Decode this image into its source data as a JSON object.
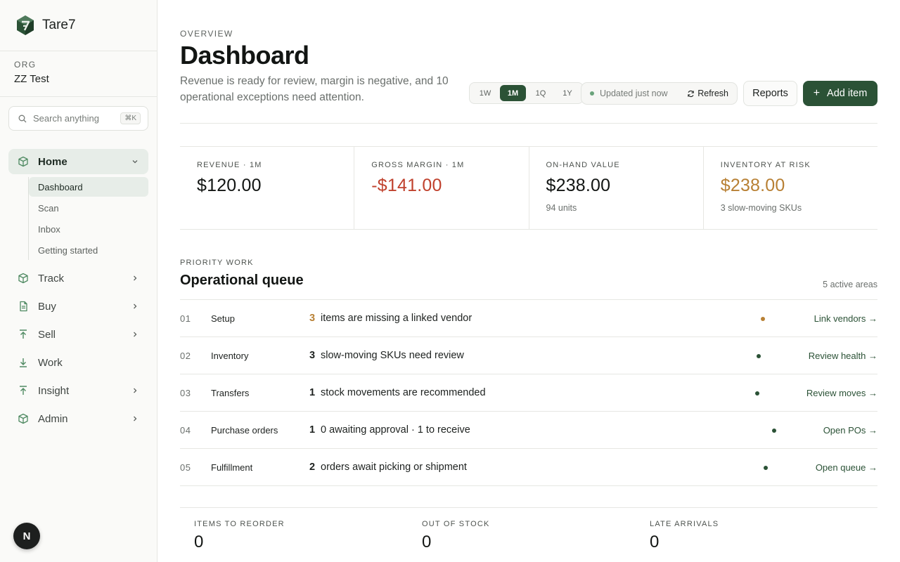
{
  "brand": {
    "name": "Tare7"
  },
  "org": {
    "label": "ORG",
    "name": "ZZ Test"
  },
  "search": {
    "placeholder": "Search anything",
    "shortcut": "⌘K"
  },
  "nav": {
    "home": "Home",
    "sub": [
      "Dashboard",
      "Scan",
      "Inbox",
      "Getting started"
    ],
    "track": "Track",
    "buy": "Buy",
    "sell": "Sell",
    "work": "Work",
    "insight": "Insight",
    "admin": "Admin"
  },
  "user": {
    "initial": "N"
  },
  "header": {
    "eyebrow": "OVERVIEW",
    "title": "Dashboard",
    "subtitle": "Revenue is ready for review, margin is negative, and 10 operational exceptions need attention."
  },
  "range": {
    "options": [
      "1W",
      "1M",
      "1Q",
      "1Y"
    ],
    "selected": "1M"
  },
  "status": {
    "updated": "Updated just now",
    "refresh": "Refresh"
  },
  "actions": {
    "reports": "Reports",
    "add_item": "Add item"
  },
  "metrics": [
    {
      "label": "REVENUE · 1M",
      "value": "$120.00",
      "sub": ""
    },
    {
      "label": "GROSS MARGIN · 1M",
      "value": "-$141.00",
      "sub": ""
    },
    {
      "label": "ON-HAND VALUE",
      "value": "$238.00",
      "sub": "94 units"
    },
    {
      "label": "INVENTORY AT RISK",
      "value": "$238.00",
      "sub": "3 slow-moving SKUs"
    }
  ],
  "priority": {
    "eyebrow": "PRIORITY WORK",
    "title": "Operational queue",
    "count": "5 active areas",
    "rows": [
      {
        "num": "01",
        "area": "Setup",
        "count": "3",
        "desc": "items are missing a linked vendor",
        "action": "Link vendors →"
      },
      {
        "num": "02",
        "area": "Inventory",
        "count": "3",
        "desc": "slow-moving SKUs need review",
        "action": "Review health →"
      },
      {
        "num": "03",
        "area": "Transfers",
        "count": "1",
        "desc": "stock movements are recommended",
        "action": "Review moves →"
      },
      {
        "num": "04",
        "area": "Purchase orders",
        "count": "1",
        "desc": "0 awaiting approval · 1 to receive",
        "action": "Open POs →"
      },
      {
        "num": "05",
        "area": "Fulfillment",
        "count": "2",
        "desc": "orders await picking or shipment",
        "action": "Open queue →"
      }
    ]
  },
  "bottom": [
    {
      "label": "ITEMS TO REORDER",
      "value": "0"
    },
    {
      "label": "OUT OF STOCK",
      "value": "0"
    },
    {
      "label": "LATE ARRIVALS",
      "value": "0"
    }
  ],
  "colors": {
    "accent": "#2b5236",
    "negative": "#c0412d",
    "warning": "#b88034",
    "active_bg": "#e7ede8"
  }
}
